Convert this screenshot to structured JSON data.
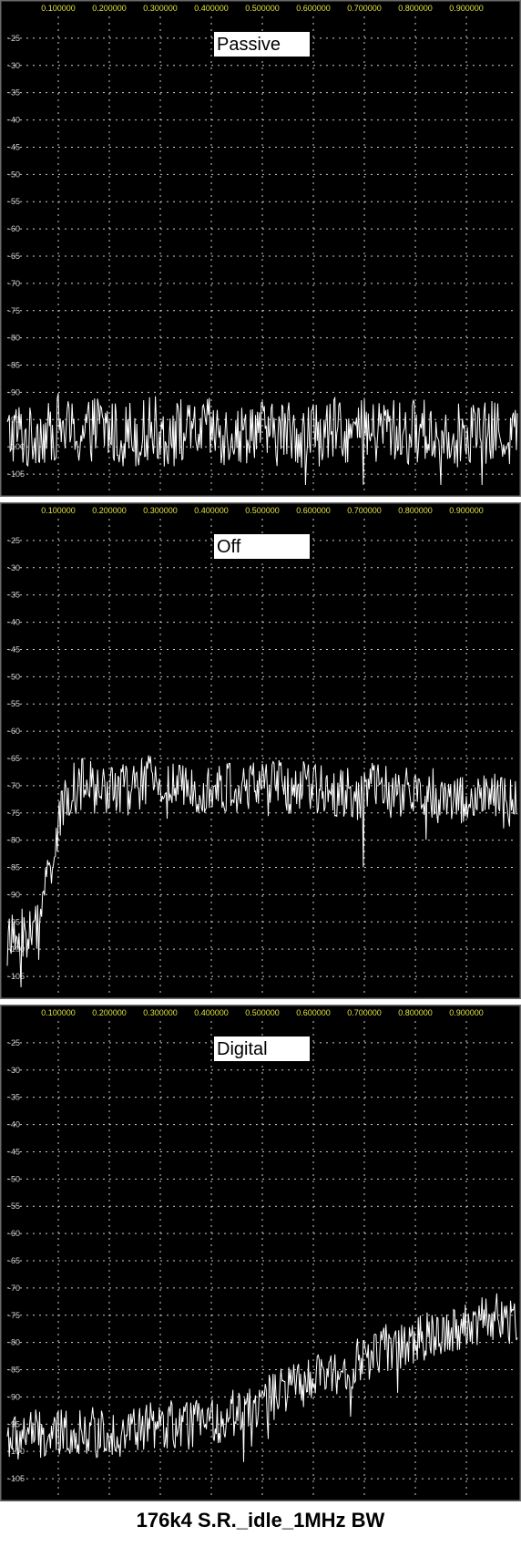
{
  "caption": "176k4 S.R._idle_1MHz BW",
  "colors": {
    "plot_bg": "#000000",
    "frame": "#6a6a6a",
    "grid": "#cfcfcf",
    "x_tick_text": "#e0e040",
    "y_tick_text": "#d0d0d0",
    "trace": "#ffffff",
    "label_bg": "#ffffff",
    "label_text": "#000000"
  },
  "x_ticks": [
    "0.100000",
    "0.200000",
    "0.300000",
    "0.400000",
    "0.500000",
    "0.600000",
    "0.700000",
    "0.800000",
    "0.900000"
  ],
  "y_ticks": [
    "-25",
    "-30",
    "-35",
    "-40",
    "-45",
    "-50",
    "-55",
    "-60",
    "-65",
    "-70",
    "-75",
    "-80",
    "-85",
    "-90",
    "-95",
    "-100",
    "-105"
  ],
  "chart_data": [
    {
      "type": "line",
      "label": "Passive",
      "xlim": [
        0.0,
        1.0
      ],
      "ylim": [
        -108,
        -21
      ],
      "grid": true,
      "x_ticks": [
        0.1,
        0.2,
        0.3,
        0.4,
        0.5,
        0.6,
        0.7,
        0.8,
        0.9
      ],
      "y_ticks": [
        -25,
        -30,
        -35,
        -40,
        -45,
        -50,
        -55,
        -60,
        -65,
        -70,
        -75,
        -80,
        -85,
        -90,
        -95,
        -100,
        -105
      ],
      "x": [
        0.0,
        0.02,
        0.04,
        0.06,
        0.08,
        0.1,
        0.12,
        0.14,
        0.16,
        0.18,
        0.2,
        0.22,
        0.24,
        0.26,
        0.28,
        0.3,
        0.32,
        0.34,
        0.36,
        0.38,
        0.4,
        0.42,
        0.44,
        0.46,
        0.48,
        0.5,
        0.52,
        0.54,
        0.56,
        0.58,
        0.6,
        0.62,
        0.64,
        0.66,
        0.68,
        0.7,
        0.72,
        0.74,
        0.76,
        0.78,
        0.8,
        0.82,
        0.84,
        0.86,
        0.88,
        0.9,
        0.92,
        0.94,
        0.96,
        0.98,
        1.0
      ],
      "y": [
        -98,
        -97,
        -99,
        -97,
        -98,
        -96,
        -97,
        -98,
        -97,
        -96,
        -97,
        -98,
        -97,
        -98,
        -96,
        -97,
        -98,
        -97,
        -98,
        -97,
        -97,
        -98,
        -97,
        -98,
        -96,
        -97,
        -98,
        -97,
        -97,
        -98,
        -97,
        -98,
        -97,
        -97,
        -98,
        -97,
        -98,
        -96,
        -97,
        -98,
        -97,
        -97,
        -98,
        -97,
        -98,
        -97,
        -97,
        -98,
        -97,
        -98,
        -97
      ],
      "noise_amplitude": 12
    },
    {
      "type": "line",
      "label": "Off",
      "xlim": [
        0.0,
        1.0
      ],
      "ylim": [
        -108,
        -21
      ],
      "grid": true,
      "x_ticks": [
        0.1,
        0.2,
        0.3,
        0.4,
        0.5,
        0.6,
        0.7,
        0.8,
        0.9
      ],
      "y_ticks": [
        -25,
        -30,
        -35,
        -40,
        -45,
        -50,
        -55,
        -60,
        -65,
        -70,
        -75,
        -80,
        -85,
        -90,
        -95,
        -100,
        -105
      ],
      "x": [
        0.0,
        0.02,
        0.04,
        0.06,
        0.08,
        0.1,
        0.12,
        0.14,
        0.16,
        0.18,
        0.2,
        0.22,
        0.24,
        0.26,
        0.28,
        0.3,
        0.32,
        0.34,
        0.36,
        0.38,
        0.4,
        0.42,
        0.44,
        0.46,
        0.48,
        0.5,
        0.52,
        0.54,
        0.56,
        0.58,
        0.6,
        0.62,
        0.64,
        0.66,
        0.68,
        0.7,
        0.72,
        0.74,
        0.76,
        0.78,
        0.8,
        0.82,
        0.84,
        0.86,
        0.88,
        0.9,
        0.92,
        0.94,
        0.96,
        0.98,
        1.0
      ],
      "y": [
        -99,
        -98,
        -97,
        -96,
        -86,
        -78,
        -71,
        -70,
        -70,
        -71,
        -70,
        -70,
        -71,
        -70,
        -69,
        -70,
        -70,
        -71,
        -70,
        -70,
        -70,
        -71,
        -70,
        -71,
        -70,
        -69,
        -70,
        -70,
        -71,
        -70,
        -71,
        -70,
        -71,
        -71,
        -72,
        -71,
        -70,
        -71,
        -72,
        -71,
        -72,
        -72,
        -71,
        -72,
        -72,
        -73,
        -72,
        -72,
        -73,
        -73,
        -74
      ],
      "noise_amplitude": 10
    },
    {
      "type": "line",
      "label": "Digital",
      "xlim": [
        0.0,
        1.0
      ],
      "ylim": [
        -108,
        -21
      ],
      "grid": true,
      "x_ticks": [
        0.1,
        0.2,
        0.3,
        0.4,
        0.5,
        0.6,
        0.7,
        0.8,
        0.9
      ],
      "y_ticks": [
        -25,
        -30,
        -35,
        -40,
        -45,
        -50,
        -55,
        -60,
        -65,
        -70,
        -75,
        -80,
        -85,
        -90,
        -95,
        -100,
        -105
      ],
      "x": [
        0.0,
        0.02,
        0.04,
        0.06,
        0.08,
        0.1,
        0.12,
        0.14,
        0.16,
        0.18,
        0.2,
        0.22,
        0.24,
        0.26,
        0.28,
        0.3,
        0.32,
        0.34,
        0.36,
        0.38,
        0.4,
        0.42,
        0.44,
        0.46,
        0.48,
        0.5,
        0.52,
        0.54,
        0.56,
        0.58,
        0.6,
        0.62,
        0.64,
        0.66,
        0.68,
        0.7,
        0.72,
        0.74,
        0.76,
        0.78,
        0.8,
        0.82,
        0.84,
        0.86,
        0.88,
        0.9,
        0.92,
        0.94,
        0.96,
        0.98,
        1.0
      ],
      "y": [
        -97,
        -98,
        -96,
        -97,
        -98,
        -97,
        -96,
        -97,
        -96,
        -97,
        -96,
        -97,
        -96,
        -96,
        -95,
        -96,
        -95,
        -96,
        -95,
        -94,
        -95,
        -94,
        -93,
        -92,
        -92,
        -91,
        -90,
        -89,
        -88,
        -88,
        -87,
        -86,
        -86,
        -85,
        -84,
        -83,
        -82,
        -81,
        -81,
        -80,
        -80,
        -79,
        -78,
        -78,
        -77,
        -77,
        -76,
        -76,
        -75,
        -76,
        -75
      ],
      "noise_amplitude": 9
    }
  ]
}
